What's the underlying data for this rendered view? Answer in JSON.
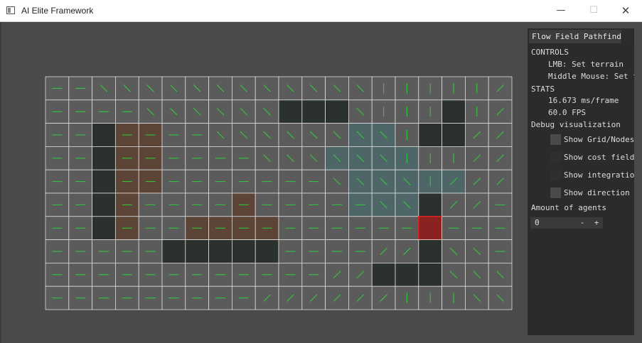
{
  "window": {
    "title": "AI Elite Framework",
    "minimize_glyph": "—",
    "maximize_glyph": "☐",
    "close_glyph": "✕"
  },
  "panel": {
    "title": "Flow Field Pathfinder",
    "controls_header": "CONTROLS",
    "controls": [
      "LMB: Set terrain",
      "Middle Mouse: Set target"
    ],
    "stats_header": "STATS",
    "frame_time": "16.673 ms/frame",
    "fps": "60.0 FPS",
    "debug_header": "Debug visualization",
    "checkboxes": [
      {
        "label": "Show Grid/Nodes",
        "checked": false,
        "highlighted": true
      },
      {
        "label": "Show cost field",
        "checked": false,
        "highlighted": false
      },
      {
        "label": "Show integration field",
        "checked": false,
        "highlighted": false
      },
      {
        "label": "Show direction field",
        "checked": false,
        "highlighted": true
      }
    ],
    "agents_label": "Amount of agents",
    "agents_value": "0",
    "minus_label": "-",
    "plus_label": "+"
  },
  "grid": {
    "cols": 20,
    "rows": 10,
    "colors": {
      "floor": "#5b5b5b",
      "wall": "#2b322d",
      "mud": "#5c4437",
      "water": "#4f6669",
      "target": "#8b2222",
      "grid_line": "#dddddd",
      "arrow": "#2fd13a",
      "background": "#4a4a4a"
    },
    "walls": [
      [
        10,
        1
      ],
      [
        11,
        1
      ],
      [
        12,
        1
      ],
      [
        17,
        1
      ],
      [
        2,
        2
      ],
      [
        16,
        2
      ],
      [
        17,
        2
      ],
      [
        2,
        3
      ],
      [
        2,
        4
      ],
      [
        2,
        5
      ],
      [
        16,
        5
      ],
      [
        2,
        6
      ],
      [
        5,
        7
      ],
      [
        6,
        7
      ],
      [
        7,
        7
      ],
      [
        8,
        7
      ],
      [
        9,
        7
      ],
      [
        16,
        7
      ],
      [
        14,
        8
      ],
      [
        15,
        8
      ],
      [
        16,
        8
      ]
    ],
    "mud": [
      [
        3,
        2
      ],
      [
        4,
        2
      ],
      [
        3,
        3
      ],
      [
        4,
        3
      ],
      [
        3,
        4
      ],
      [
        4,
        4
      ],
      [
        3,
        5
      ],
      [
        8,
        5
      ],
      [
        3,
        6
      ],
      [
        6,
        6
      ],
      [
        7,
        6
      ],
      [
        8,
        6
      ],
      [
        9,
        6
      ]
    ],
    "water": [
      [
        13,
        2
      ],
      [
        14,
        2
      ],
      [
        12,
        3
      ],
      [
        13,
        3
      ],
      [
        14,
        3
      ],
      [
        15,
        3
      ],
      [
        13,
        4
      ],
      [
        14,
        4
      ],
      [
        15,
        4
      ],
      [
        16,
        4
      ],
      [
        17,
        4
      ],
      [
        13,
        5
      ],
      [
        14,
        5
      ],
      [
        15,
        5
      ]
    ],
    "target": [
      16,
      6
    ]
  }
}
